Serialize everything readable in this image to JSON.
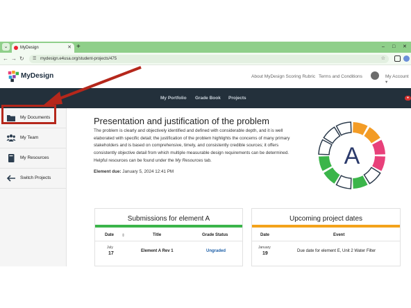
{
  "browser": {
    "tab_title": "MyDesign",
    "url": "mydesign.e4usa.org/student-projects/475"
  },
  "header": {
    "logo_text": "MyDesign",
    "links": [
      "About MyDesign Scoring Rubric",
      "Terms and Conditions"
    ],
    "account_label": "My Account ▾"
  },
  "topnav": {
    "items": [
      "My Portfolio",
      "Grade Book",
      "Projects"
    ]
  },
  "sidebar": {
    "items": [
      {
        "label": "My Documents",
        "icon": "folder-icon"
      },
      {
        "label": "My Team",
        "icon": "team-icon"
      },
      {
        "label": "My Resources",
        "icon": "book-icon"
      },
      {
        "label": "Switch Projects",
        "icon": "arrow-left-icon"
      }
    ]
  },
  "main": {
    "title": "Presentation and justification of the problem",
    "description": "The problem is clearly and objectively identified and defined with considerable depth, and it is well elaborated with specific detail; the justification of the problem highlights the concerns of many primary stakeholders and is based on comprehensive, timely, and consistently credible sources; it offers consistently objective detail from which multiple measurable design requirements can be determined.",
    "helpful_prefix": "Helpful resources can be found under the ",
    "helpful_link": "My Resources",
    "helpful_suffix": " tab.",
    "due_label": "Element due:",
    "due_value": " January 5, 2024 12:41 PM",
    "element_letter": "A"
  },
  "submissions": {
    "title": "Submissions for element A",
    "columns": [
      "Date",
      "Title",
      "Grade Status"
    ],
    "rows": [
      {
        "month": "July",
        "day": "17",
        "title": "Element A Rev 1",
        "status": "Ungraded"
      }
    ]
  },
  "upcoming": {
    "title": "Upcoming project dates",
    "columns": [
      "Date",
      "Event"
    ],
    "rows": [
      {
        "month": "January",
        "day": "19",
        "event": "Due date for element E, Unit 2 Water Filter"
      }
    ]
  },
  "colors": {
    "accent_green": "#3bb54a",
    "accent_orange": "#f39c26",
    "accent_pink": "#e8407a",
    "navy": "#23303b",
    "highlight_red": "#b5271b"
  }
}
